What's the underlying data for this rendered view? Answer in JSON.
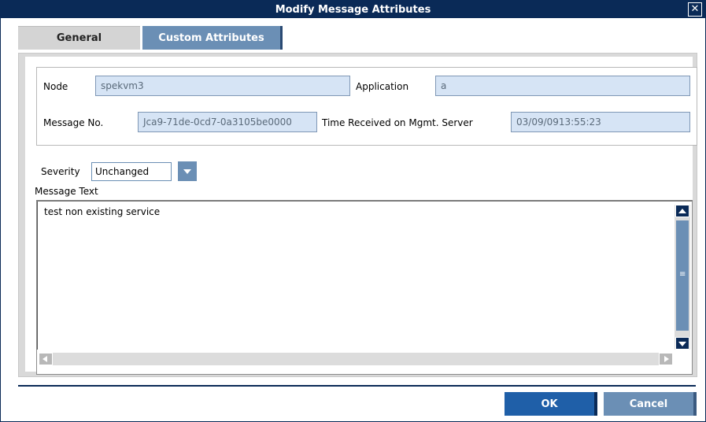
{
  "window": {
    "title": "Modify Message Attributes",
    "close_glyph": "✕"
  },
  "tabs": [
    {
      "label": "General",
      "selected": true
    },
    {
      "label": "Custom Attributes",
      "selected": false
    }
  ],
  "fields": {
    "node": {
      "label": "Node",
      "value": "spekvm3"
    },
    "application": {
      "label": "Application",
      "value": "a"
    },
    "message_no": {
      "label": "Message No.",
      "value": "Jca9-71de-0cd7-0a3105be0000"
    },
    "time_received": {
      "label": "Time Received on Mgmt. Server",
      "value": "03/09/0913:55:23"
    }
  },
  "severity": {
    "label": "Severity",
    "value": "Unchanged"
  },
  "message_text": {
    "label": "Message Text",
    "value": "test non existing service"
  },
  "buttons": {
    "ok": "OK",
    "cancel": "Cancel"
  },
  "icons": {
    "close": "close-icon",
    "dropdown": "chevron-down-icon"
  },
  "colors": {
    "titlebar": "#0a2a57",
    "tab_inactive": "#6b8fb5",
    "field_bg": "#d6e4f5",
    "ok_button": "#1f5fa8"
  }
}
